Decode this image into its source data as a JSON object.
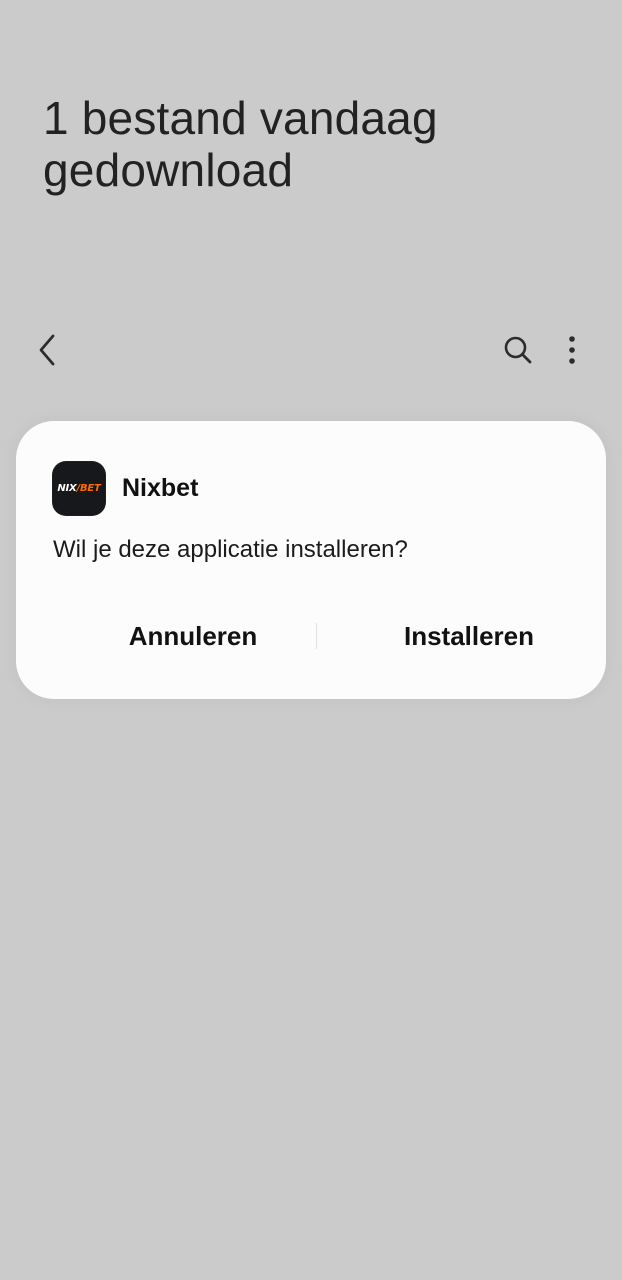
{
  "header": {
    "title": "1 bestand vandaag\ngedownload"
  },
  "toolbar": {
    "back_icon": "chevron-left-icon",
    "search_icon": "search-icon",
    "more_icon": "more-vertical-icon"
  },
  "dialog": {
    "app_name": "Nixbet",
    "app_icon_text_left": "NIX",
    "app_icon_text_right": "BET",
    "question": "Wil je deze applicatie installeren?",
    "cancel_label": "Annuleren",
    "install_label": "Installeren"
  },
  "colors": {
    "background": "#cbcbcb",
    "dialog": "#fcfcfc",
    "text_primary": "#121212",
    "icon_background": "#17181b",
    "icon_accent": "#ff6a00"
  }
}
